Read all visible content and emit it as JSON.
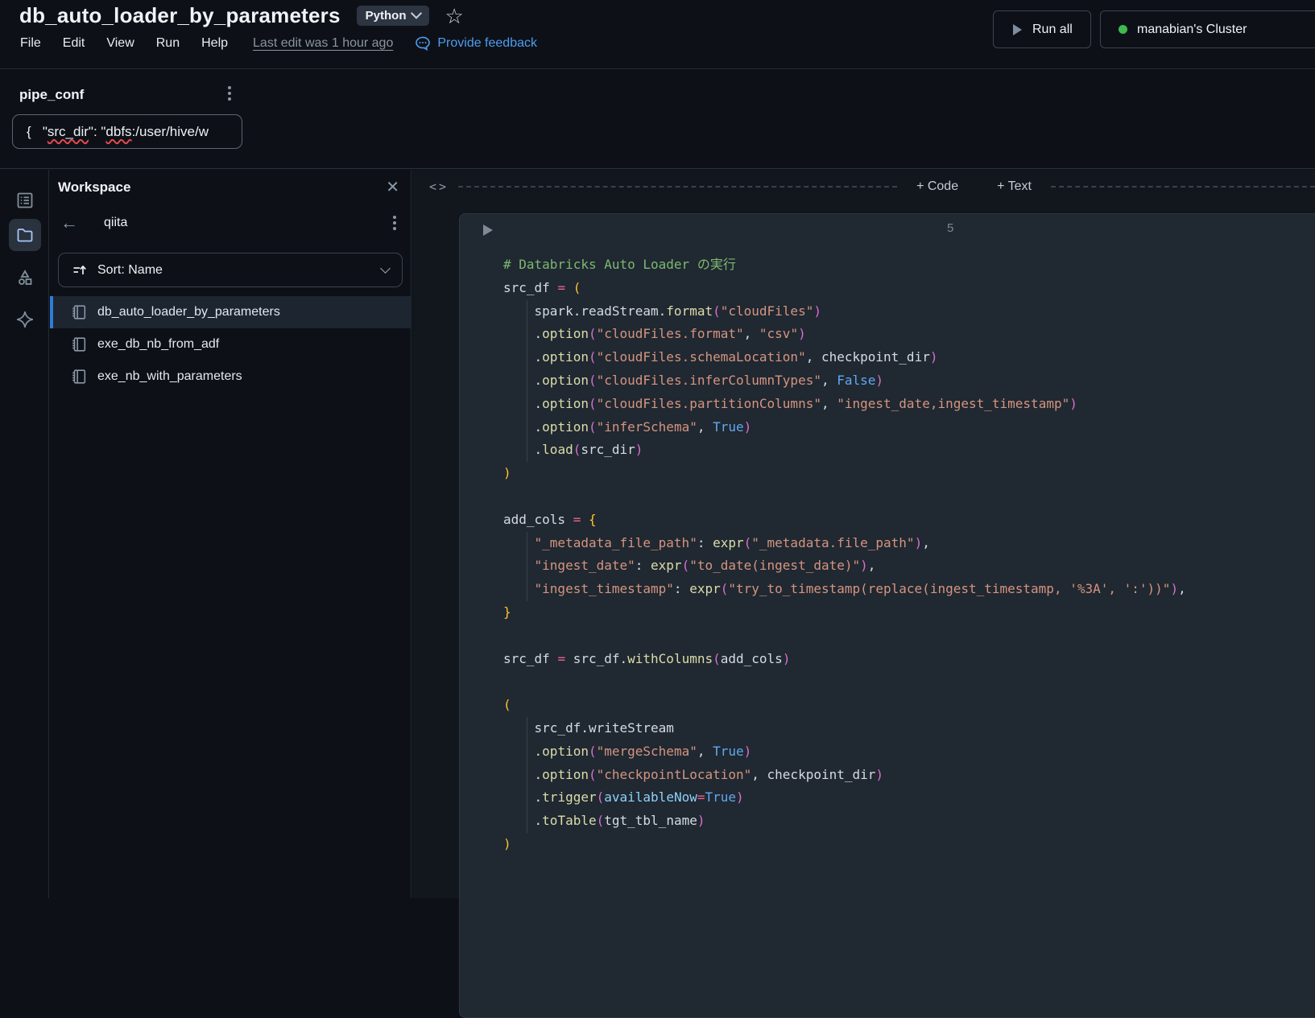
{
  "header": {
    "title": "db_auto_loader_by_parameters",
    "language": "Python",
    "menu": [
      "File",
      "Edit",
      "View",
      "Run",
      "Help"
    ],
    "last_edit": "Last edit was 1 hour ago",
    "feedback_label": "Provide feedback",
    "run_all_label": "Run all",
    "cluster_label": "manabian's Cluster"
  },
  "widget": {
    "name": "pipe_conf",
    "value_segments": [
      {
        "text": "{   \"",
        "misspelled": false
      },
      {
        "text": "src_dir",
        "misspelled": true
      },
      {
        "text": "\": \"",
        "misspelled": false
      },
      {
        "text": "dbfs",
        "misspelled": true
      },
      {
        "text": ":/user/hive/w",
        "misspelled": false
      }
    ]
  },
  "workspace": {
    "title": "Workspace",
    "folder": "qiita",
    "sort_label": "Sort: Name",
    "files": [
      {
        "name": "db_auto_loader_by_parameters",
        "selected": true
      },
      {
        "name": "exe_db_nb_from_adf",
        "selected": false
      },
      {
        "name": "exe_nb_with_parameters",
        "selected": false
      }
    ]
  },
  "notebook": {
    "add_code_label": "+ Code",
    "add_text_label": "+ Text",
    "cell_number": "5",
    "code_lines": [
      [
        [
          "c",
          "# Databricks Auto Loader の実行"
        ]
      ],
      [
        [
          "v",
          "src_df "
        ],
        [
          "k",
          "="
        ],
        [
          "v",
          " "
        ],
        [
          "g",
          "("
        ]
      ],
      [
        [
          "v",
          "    spark.readStream."
        ],
        [
          "f",
          "format"
        ],
        [
          "m",
          "("
        ],
        [
          "s",
          "\"cloudFiles\""
        ],
        [
          "m",
          ")"
        ]
      ],
      [
        [
          "v",
          "    ."
        ],
        [
          "f",
          "option"
        ],
        [
          "m",
          "("
        ],
        [
          "s",
          "\"cloudFiles.format\""
        ],
        [
          "v",
          ", "
        ],
        [
          "s",
          "\"csv\""
        ],
        [
          "m",
          ")"
        ]
      ],
      [
        [
          "v",
          "    ."
        ],
        [
          "f",
          "option"
        ],
        [
          "m",
          "("
        ],
        [
          "s",
          "\"cloudFiles.schemaLocation\""
        ],
        [
          "v",
          ", checkpoint_dir"
        ],
        [
          "m",
          ")"
        ]
      ],
      [
        [
          "v",
          "    ."
        ],
        [
          "f",
          "option"
        ],
        [
          "m",
          "("
        ],
        [
          "s",
          "\"cloudFiles.inferColumnTypes\""
        ],
        [
          "v",
          ", "
        ],
        [
          "b",
          "False"
        ],
        [
          "m",
          ")"
        ]
      ],
      [
        [
          "v",
          "    ."
        ],
        [
          "f",
          "option"
        ],
        [
          "m",
          "("
        ],
        [
          "s",
          "\"cloudFiles.partitionColumns\""
        ],
        [
          "v",
          ", "
        ],
        [
          "s",
          "\"ingest_date,ingest_timestamp\""
        ],
        [
          "m",
          ")"
        ]
      ],
      [
        [
          "v",
          "    ."
        ],
        [
          "f",
          "option"
        ],
        [
          "m",
          "("
        ],
        [
          "s",
          "\"inferSchema\""
        ],
        [
          "v",
          ", "
        ],
        [
          "b",
          "True"
        ],
        [
          "m",
          ")"
        ]
      ],
      [
        [
          "v",
          "    ."
        ],
        [
          "f",
          "load"
        ],
        [
          "m",
          "("
        ],
        [
          "v",
          "src_dir"
        ],
        [
          "m",
          ")"
        ]
      ],
      [
        [
          "g",
          ")"
        ]
      ],
      [],
      [
        [
          "v",
          "add_cols "
        ],
        [
          "k",
          "="
        ],
        [
          "v",
          " "
        ],
        [
          "g",
          "{"
        ]
      ],
      [
        [
          "v",
          "    "
        ],
        [
          "s",
          "\"_metadata_file_path\""
        ],
        [
          "v",
          ": "
        ],
        [
          "f",
          "expr"
        ],
        [
          "m",
          "("
        ],
        [
          "s",
          "\"_metadata.file_path\""
        ],
        [
          "m",
          ")"
        ],
        [
          "v",
          ","
        ]
      ],
      [
        [
          "v",
          "    "
        ],
        [
          "s",
          "\"ingest_date\""
        ],
        [
          "v",
          ": "
        ],
        [
          "f",
          "expr"
        ],
        [
          "m",
          "("
        ],
        [
          "s",
          "\"to_date(ingest_date)\""
        ],
        [
          "m",
          ")"
        ],
        [
          "v",
          ","
        ]
      ],
      [
        [
          "v",
          "    "
        ],
        [
          "s",
          "\"ingest_timestamp\""
        ],
        [
          "v",
          ": "
        ],
        [
          "f",
          "expr"
        ],
        [
          "m",
          "("
        ],
        [
          "s",
          "\"try_to_timestamp(replace(ingest_timestamp, '%3A', ':'))\""
        ],
        [
          "m",
          ")"
        ],
        [
          "v",
          ","
        ]
      ],
      [
        [
          "g",
          "}"
        ]
      ],
      [],
      [
        [
          "v",
          "src_df "
        ],
        [
          "k",
          "="
        ],
        [
          "v",
          " src_df."
        ],
        [
          "f",
          "withColumns"
        ],
        [
          "m",
          "("
        ],
        [
          "v",
          "add_cols"
        ],
        [
          "m",
          ")"
        ]
      ],
      [],
      [
        [
          "g",
          "("
        ]
      ],
      [
        [
          "v",
          "    src_df.writeStream"
        ]
      ],
      [
        [
          "v",
          "    ."
        ],
        [
          "f",
          "option"
        ],
        [
          "m",
          "("
        ],
        [
          "s",
          "\"mergeSchema\""
        ],
        [
          "v",
          ", "
        ],
        [
          "b",
          "True"
        ],
        [
          "m",
          ")"
        ]
      ],
      [
        [
          "v",
          "    ."
        ],
        [
          "f",
          "option"
        ],
        [
          "m",
          "("
        ],
        [
          "s",
          "\"checkpointLocation\""
        ],
        [
          "v",
          ", checkpoint_dir"
        ],
        [
          "m",
          ")"
        ]
      ],
      [
        [
          "v",
          "    ."
        ],
        [
          "f",
          "trigger"
        ],
        [
          "m",
          "("
        ],
        [
          "p",
          "availableNow"
        ],
        [
          "k",
          "="
        ],
        [
          "b",
          "True"
        ],
        [
          "m",
          ")"
        ]
      ],
      [
        [
          "v",
          "    ."
        ],
        [
          "f",
          "toTable"
        ],
        [
          "m",
          "("
        ],
        [
          "v",
          "tgt_tbl_name"
        ],
        [
          "m",
          ")"
        ]
      ],
      [
        [
          "g",
          ")"
        ]
      ]
    ]
  },
  "colors": {
    "background": "#0d1117",
    "cell_background": "#202831",
    "accent_blue": "#4f9cf0",
    "selected_bar": "#2e7cd6",
    "cluster_status_green": "#3fb950"
  }
}
